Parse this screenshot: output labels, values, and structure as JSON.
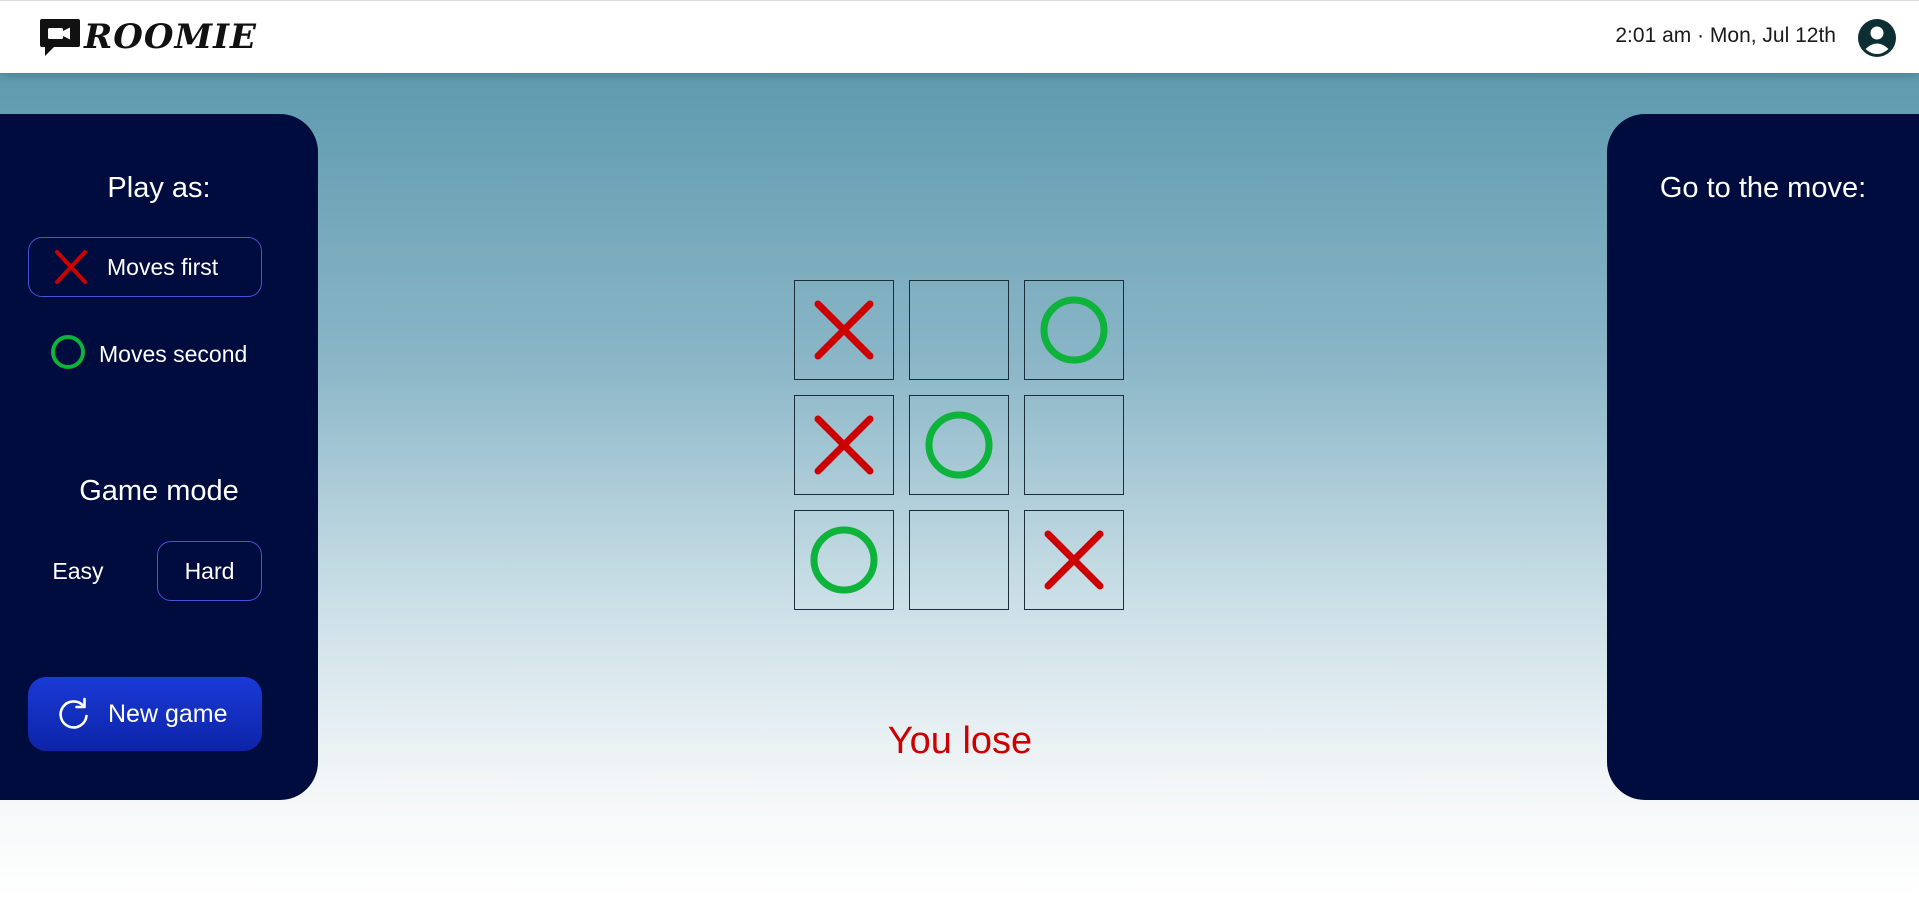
{
  "header": {
    "logo_text": "ROOMIE",
    "logo_icon": "video-camera-chat-icon",
    "clock": "2:01 am · Mon, Jul 12th",
    "user_icon": "account-circle-icon"
  },
  "left_panel": {
    "play_as_title": "Play as:",
    "options": [
      {
        "label": "Moves first",
        "symbol": "X",
        "selected": true
      },
      {
        "label": "Moves second",
        "symbol": "O",
        "selected": false
      }
    ],
    "game_mode_title": "Game mode",
    "modes": [
      {
        "label": "Easy",
        "selected": false
      },
      {
        "label": "Hard",
        "selected": true
      }
    ],
    "new_game_label": "New game",
    "new_game_icon": "refresh-icon"
  },
  "right_panel": {
    "title": "Go to the move:"
  },
  "board": {
    "cells": [
      "X",
      "",
      "O",
      "X",
      "O",
      "",
      "O",
      "",
      "X"
    ]
  },
  "result": "You lose",
  "colors": {
    "x_mark": "#cc0000",
    "o_mark": "#0db33a",
    "panel": "#000c3e",
    "accent_border": "#4456d6",
    "result": "#cc0000"
  }
}
